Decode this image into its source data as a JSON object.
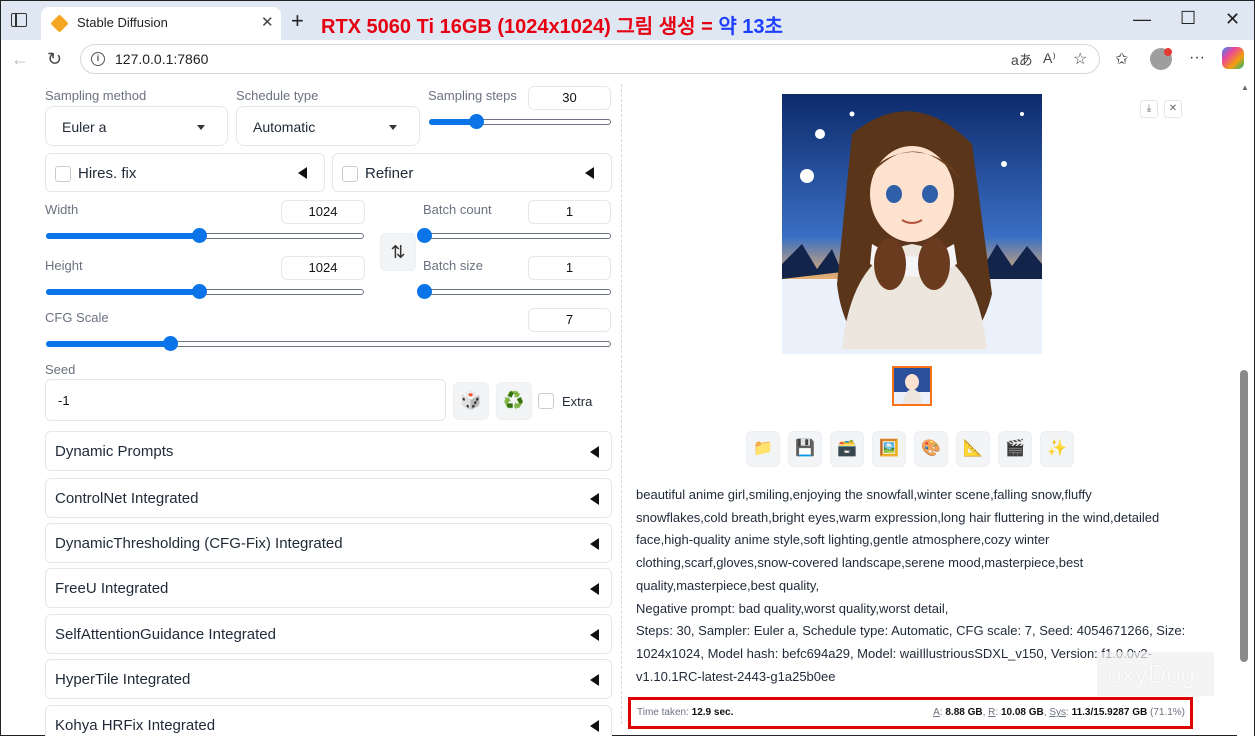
{
  "browser": {
    "tab_title": "Stable Diffusion",
    "tab_close": "✕",
    "new_tab": "+",
    "annotation_part1": "RTX 5060 Ti 16GB (1024x1024) 그림 생성 =",
    "annotation_part2": "약 13초",
    "url": "127.0.0.1:7860",
    "back": "←",
    "refresh": "↻",
    "minimize": "—",
    "maximize": "☐",
    "close": "✕"
  },
  "controls": {
    "sampling_method_label": "Sampling method",
    "sampling_method_value": "Euler a",
    "schedule_type_label": "Schedule type",
    "schedule_type_value": "Automatic",
    "sampling_steps_label": "Sampling steps",
    "sampling_steps_value": "30",
    "sampling_steps_fraction": 0.26,
    "hires_fix_label": "Hires. fix",
    "refiner_label": "Refiner",
    "width_label": "Width",
    "width_value": "1024",
    "width_fraction": 0.48,
    "height_label": "Height",
    "height_value": "1024",
    "height_fraction": 0.48,
    "swap_icon": "⇅",
    "batch_count_label": "Batch count",
    "batch_count_value": "1",
    "batch_count_fraction": 0.0,
    "batch_size_label": "Batch size",
    "batch_size_value": "1",
    "batch_size_fraction": 0.0,
    "cfg_label": "CFG Scale",
    "cfg_value": "7",
    "cfg_fraction": 0.22,
    "seed_label": "Seed",
    "seed_value": "-1",
    "dice_icon": "🎲",
    "recycle_icon": "♻️",
    "extra_label": "Extra"
  },
  "accordions": [
    "Dynamic Prompts",
    "ControlNet Integrated",
    "DynamicThresholding (CFG-Fix) Integrated",
    "FreeU Integrated",
    "SelfAttentionGuidance Integrated",
    "HyperTile Integrated",
    "Kohya HRFix Integrated"
  ],
  "output": {
    "download_icon": "⤓",
    "close_icon": "✕",
    "tools": [
      "📁",
      "💾",
      "🗃️",
      "🖼️",
      "🎨",
      "📐",
      "🎬",
      "✨"
    ],
    "info_lines": [
      "beautiful anime girl,smiling,enjoying the snowfall,winter scene,falling snow,fluffy",
      "snowflakes,cold breath,bright eyes,warm expression,long hair fluttering in the wind,detailed",
      "face,high-quality anime style,soft lighting,gentle atmosphere,cozy winter",
      "clothing,scarf,gloves,snow-covered landscape,serene mood,masterpiece,best",
      "quality,masterpiece,best quality,",
      "Negative prompt: bad quality,worst quality,worst detail,",
      "Steps: 30, Sampler: Euler a, Schedule type: Automatic, CFG scale: 7, Seed: 4054671266, Size:",
      "1024x1024, Model hash: befc694a29, Model: waiIllustriousSDXL_v150, Version: f1.0.0v2-",
      "v1.10.1RC-latest-2443-g1a25b0ee"
    ],
    "time_label": "Time taken:",
    "time_value": "12.9 sec.",
    "a_label": "A",
    "a_value": "8.88 GB",
    "r_label": "R",
    "r_value": "10.08 GB",
    "sys_label": "Sys",
    "sys_value": "11.3/15.9287 GB",
    "sys_pct": "(71.1%)"
  },
  "watermark": "oxyDog",
  "colors": {
    "accent": "#0a74e8",
    "annotation_red": "#e60012",
    "annotation_blue": "#1e3fff",
    "highlight_box": "#e00000"
  }
}
